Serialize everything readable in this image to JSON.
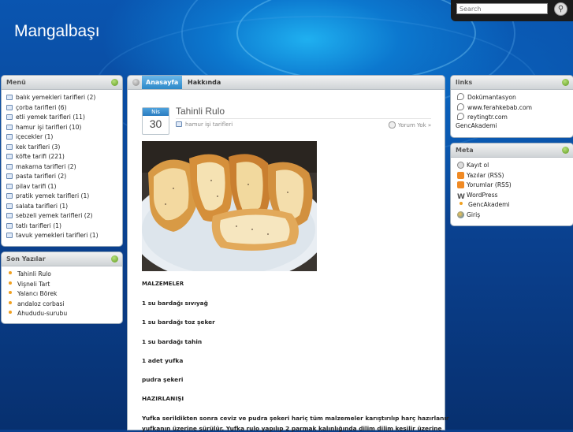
{
  "site": {
    "title": "Mangalbaşı"
  },
  "search": {
    "placeholder": "Search"
  },
  "menu": {
    "title": "Menü",
    "items": [
      {
        "label": "balık yemekleri tarifleri",
        "count": "(2)"
      },
      {
        "label": "çorba tarifleri",
        "count": "(6)"
      },
      {
        "label": "etli yemek tarifleri",
        "count": "(11)"
      },
      {
        "label": "hamur işi tarifleri",
        "count": "(10)"
      },
      {
        "label": "içecekler",
        "count": "(1)"
      },
      {
        "label": "kek tarifleri",
        "count": "(3)"
      },
      {
        "label": "köfte tarifi",
        "count": "(221)"
      },
      {
        "label": "makarna tarifleri",
        "count": "(2)"
      },
      {
        "label": "pasta tarifleri",
        "count": "(2)"
      },
      {
        "label": "pilav tarifi",
        "count": "(1)"
      },
      {
        "label": "pratik yemek tarifleri",
        "count": "(1)"
      },
      {
        "label": "salata tarifleri",
        "count": "(1)"
      },
      {
        "label": "sebzeli yemek tarifleri",
        "count": "(2)"
      },
      {
        "label": "tatlı tarifleri",
        "count": "(1)"
      },
      {
        "label": "tavuk yemekleri tarifleri",
        "count": "(1)"
      }
    ]
  },
  "recent": {
    "title": "Son Yazılar",
    "items": [
      "Tahinli Rulo",
      "Vişneli Tart",
      "Yalancı Börek",
      "andaloz corbasi",
      "Ahududu-surubu"
    ]
  },
  "tabs": {
    "home": "Anasayfa",
    "about": "Hakkında"
  },
  "post": {
    "month": "Nis",
    "day": "30",
    "title": "Tahinli Rulo",
    "category": "hamur işi tarifleri",
    "comments": "Yorum Yok »",
    "lines": [
      "MALZEMELER",
      "1 su bardağı sıvıyağ",
      "1 su bardağı toz şeker",
      "1 su bardağı tahin",
      "1 adet yufka",
      "pudra şekeri",
      "HAZIRLANIŞI",
      "Yufka serildikten sonra ceviz ve pudra şekeri hariç tüm malzemeler karıştırılıp harç hazırlanır",
      "yufkanın üzerine sürülür. Yufka rulo yapılıp 2 parmak kalınlığında dilim dilim kesilir üzerine"
    ]
  },
  "links": {
    "title": "links",
    "items": [
      "Dokümantasyon",
      "www.ferahkebab.com",
      "reytingtr.com"
    ],
    "extra": "GencAkademi"
  },
  "meta": {
    "title": "Meta",
    "items": [
      "Kayıt ol",
      "Yazılar (RSS)",
      "Yorumlar (RSS)",
      "WordPress",
      "GencAkademi",
      "Giriş"
    ]
  }
}
